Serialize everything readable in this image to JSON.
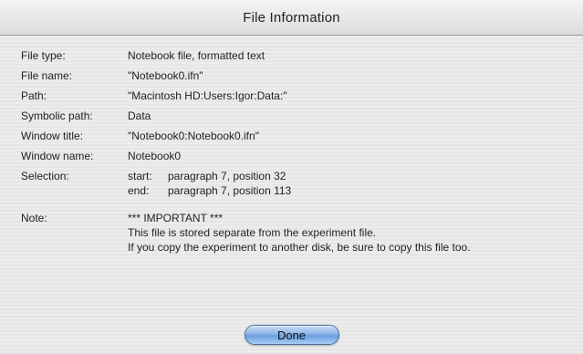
{
  "window": {
    "title": "File Information"
  },
  "fields": {
    "file_type": {
      "label": "File type:",
      "value": "Notebook file, formatted text"
    },
    "file_name": {
      "label": "File name:",
      "value": "\"Notebook0.ifn\""
    },
    "path": {
      "label": "Path:",
      "value": "\"Macintosh HD:Users:Igor:Data:\""
    },
    "symbolic_path": {
      "label": "Symbolic path:",
      "value": "Data"
    },
    "window_title": {
      "label": "Window title:",
      "value": "\"Notebook0:Notebook0.ifn\""
    },
    "window_name": {
      "label": "Window name:",
      "value": "Notebook0"
    },
    "selection": {
      "label": "Selection:",
      "start_key": "start:",
      "start_value": "paragraph 7, position 32",
      "end_key": "end:",
      "end_value": "paragraph 7, position 113"
    },
    "note": {
      "label": "Note:",
      "line1": "*** IMPORTANT ***",
      "line2": "This file is stored separate from the experiment file.",
      "line3": "If you copy the experiment to another disk, be sure to copy this file too."
    }
  },
  "buttons": {
    "done_label": "Done"
  }
}
